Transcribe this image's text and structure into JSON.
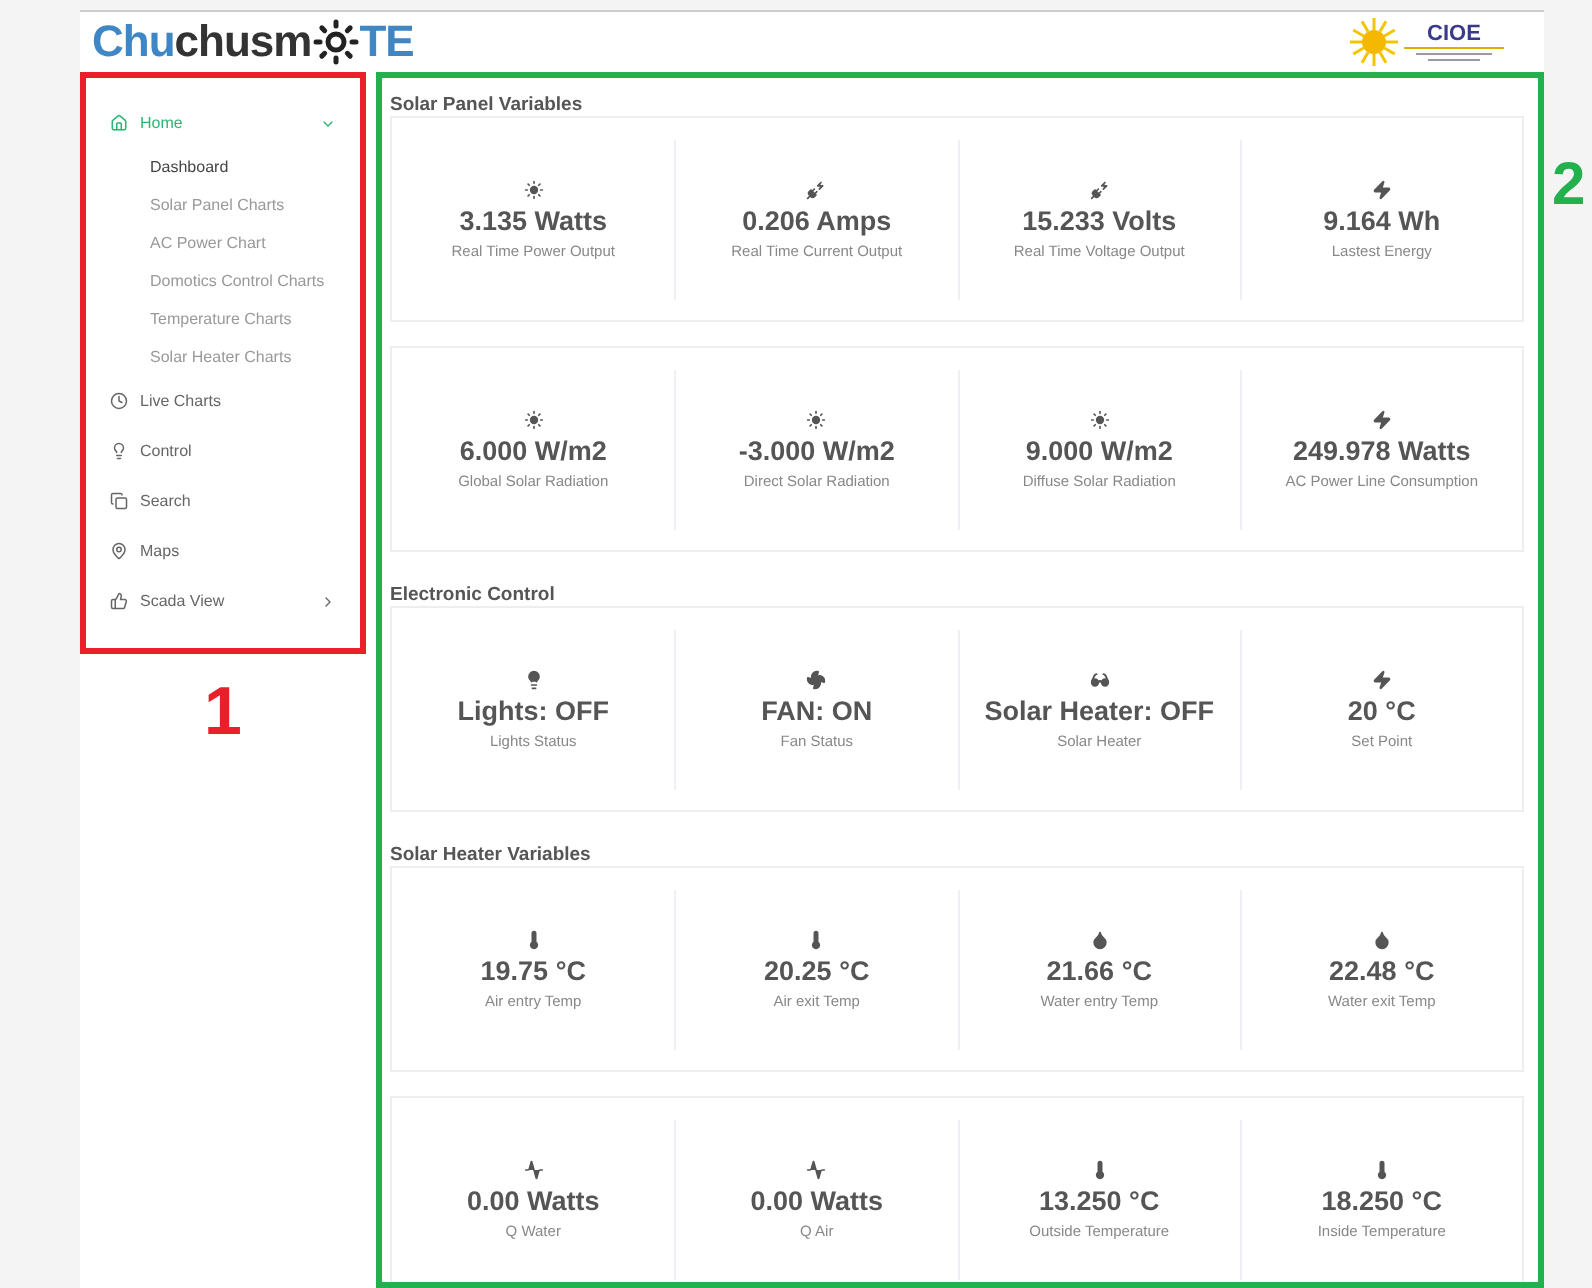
{
  "header": {
    "logo_parts": [
      {
        "text": "Chu",
        "color": "#3f86c4"
      },
      {
        "text": "chusm",
        "color": "#333333"
      },
      {
        "text": "TE",
        "color": "#3f86c4"
      }
    ],
    "partner_logo": "CIOE"
  },
  "sidebar": {
    "items": [
      {
        "label": "Home",
        "kind": "home",
        "selected": true,
        "expanded": true,
        "children": [
          {
            "label": "Dashboard",
            "selected": true
          },
          {
            "label": "Solar Panel Charts",
            "selected": false
          },
          {
            "label": "AC Power Chart",
            "selected": false
          },
          {
            "label": "Domotics Control Charts",
            "selected": false
          },
          {
            "label": "Temperature Charts",
            "selected": false
          },
          {
            "label": "Solar Heater Charts",
            "selected": false
          }
        ]
      },
      {
        "label": "Live Charts",
        "kind": "clock",
        "selected": false
      },
      {
        "label": "Control",
        "kind": "bulb",
        "selected": false
      },
      {
        "label": "Search",
        "kind": "copy",
        "selected": false
      },
      {
        "label": "Maps",
        "kind": "pin",
        "selected": false
      },
      {
        "label": "Scada View",
        "kind": "thumb",
        "selected": false,
        "expanded": false
      }
    ]
  },
  "annotations": [
    {
      "label": "1",
      "color": "#e8202a"
    },
    {
      "label": "2",
      "color": "#22b14c"
    }
  ],
  "sections": [
    {
      "title": "Solar Panel Variables",
      "cards": [
        [
          {
            "kind": "sun",
            "value": "3.135 Watts",
            "label": "Real Time Power Output"
          },
          {
            "kind": "plug",
            "value": "0.206 Amps",
            "label": "Real Time Current Output"
          },
          {
            "kind": "plug",
            "value": "15.233 Volts",
            "label": "Real Time Voltage Output"
          },
          {
            "kind": "bolt",
            "value": "9.164 Wh",
            "label": "Lastest Energy"
          }
        ],
        [
          {
            "kind": "sun",
            "value": "6.000 W/m2",
            "label": "Global Solar Radiation"
          },
          {
            "kind": "sun",
            "value": "-3.000 W/m2",
            "label": "Direct Solar Radiation"
          },
          {
            "kind": "sun",
            "value": "9.000 W/m2",
            "label": "Diffuse Solar Radiation"
          },
          {
            "kind": "bolt",
            "value": "249.978 Watts",
            "label": "AC Power Line Consumption"
          }
        ]
      ]
    },
    {
      "title": "Electronic Control",
      "cards": [
        [
          {
            "kind": "bulb",
            "value": "Lights: OFF",
            "label": "Lights Status"
          },
          {
            "kind": "fan",
            "value": "FAN: ON",
            "label": "Fan Status"
          },
          {
            "kind": "glasses",
            "value": "Solar Heater: OFF",
            "label": "Solar Heater"
          },
          {
            "kind": "bolt",
            "value": "20 °C",
            "label": "Set Point"
          }
        ]
      ]
    },
    {
      "title": "Solar Heater Variables",
      "cards": [
        [
          {
            "kind": "thermo",
            "value": "19.75 °C",
            "label": "Air entry Temp"
          },
          {
            "kind": "thermo",
            "value": "20.25 °C",
            "label": "Air exit Temp"
          },
          {
            "kind": "drop",
            "value": "21.66 °C",
            "label": "Water entry Temp"
          },
          {
            "kind": "drop",
            "value": "22.48 °C",
            "label": "Water exit Temp"
          }
        ],
        [
          {
            "kind": "pulse",
            "value": "0.00 Watts",
            "label": "Q Water"
          },
          {
            "kind": "pulse",
            "value": "0.00 Watts",
            "label": "Q Air"
          },
          {
            "kind": "thermo",
            "value": "13.250 °C",
            "label": "Outside Temperature"
          },
          {
            "kind": "thermo",
            "value": "18.250 °C",
            "label": "Inside Temperature"
          }
        ]
      ]
    }
  ]
}
